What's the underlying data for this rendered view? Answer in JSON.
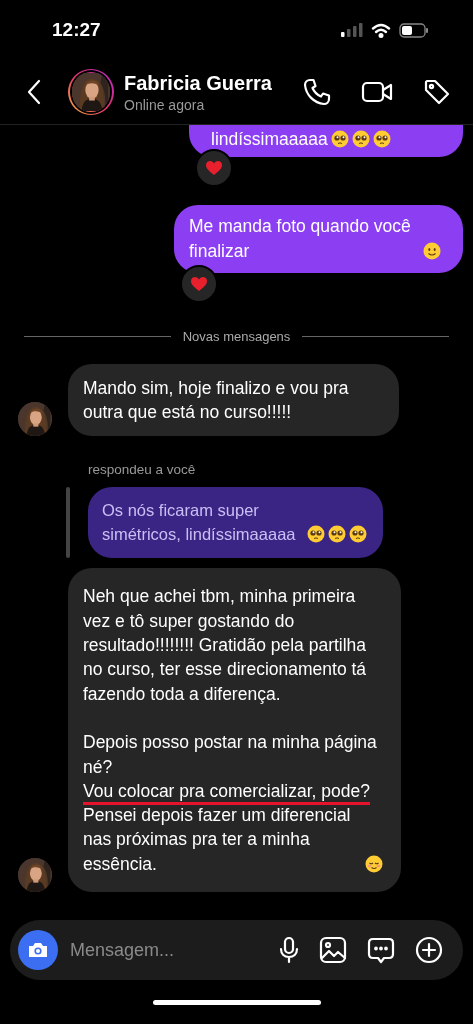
{
  "status_bar": {
    "time": "12:27"
  },
  "header": {
    "name": "Fabricia Guerra",
    "status": "Online agora"
  },
  "messages": [
    {
      "kind": "sent",
      "text": "lindíssimaaaaa",
      "emojis": [
        {
          "kind": "pleading"
        },
        {
          "kind": "pleading"
        },
        {
          "kind": "pleading"
        }
      ],
      "reaction": {
        "kind": "heart"
      }
    },
    {
      "kind": "sent",
      "text": "Me manda foto quando você finalizar",
      "emojis": [
        {
          "kind": "smile"
        }
      ],
      "reaction": {
        "kind": "heart"
      }
    },
    {
      "kind": "divider",
      "text": "Novas mensagens"
    },
    {
      "kind": "received",
      "avatar": true,
      "blocks": [
        [
          {
            "text": "Mando sim, hoje finalizo e vou pra outra que está no curso!!!!!",
            "underlined": false
          }
        ]
      ]
    },
    {
      "kind": "reply_label",
      "text": "respondeu a você"
    },
    {
      "kind": "quote",
      "text": "Os nós ficaram super simétricos, lindíssimaaaaa",
      "emojis": [
        {
          "kind": "pleading"
        },
        {
          "kind": "pleading"
        },
        {
          "kind": "pleading"
        }
      ]
    },
    {
      "kind": "received",
      "avatar": true,
      "blocks": [
        [
          {
            "text": "Neh que achei tbm, minha primeira vez e tô super gostando do resultado!!!!!!!! Gratidão pela partilha no curso, ter esse direcionamento tá fazendo toda a diferença.",
            "underlined": false
          }
        ],
        [
          {
            "text": "Depois posso postar na minha página né?",
            "underlined": false
          },
          {
            "text": "Vou colocar pra comercializar, pode?",
            "underlined": true
          },
          {
            "text": "Pensei depois fazer um diferencial nas próximas pra ter a minha essência.",
            "underlined": false,
            "emojis": [
              {
                "kind": "blush"
              }
            ]
          }
        ]
      ]
    }
  ],
  "composer": {
    "placeholder": "Mensagem..."
  }
}
